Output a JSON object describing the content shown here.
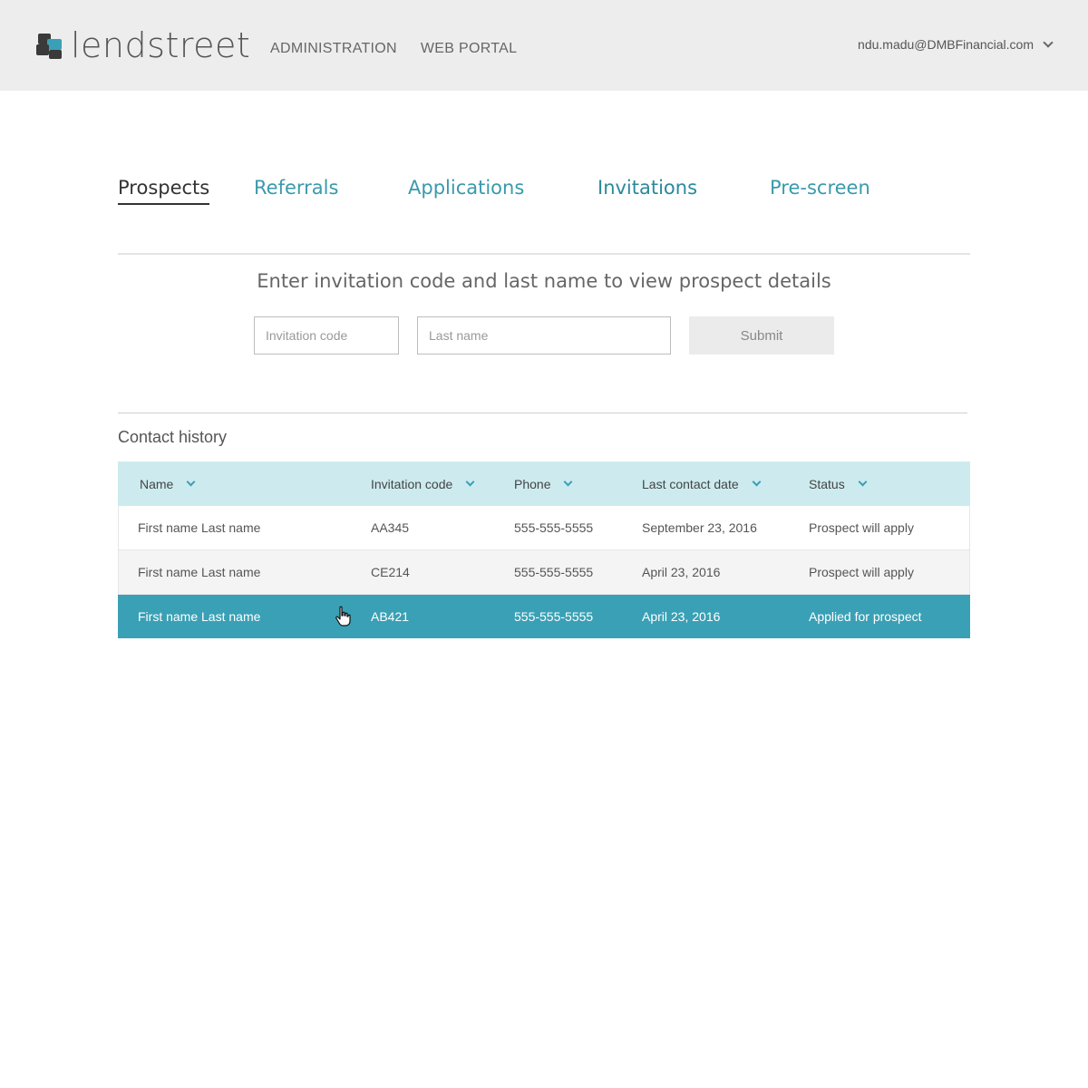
{
  "header": {
    "brand_name": "lendstreet",
    "nav": [
      "ADMINISTRATION",
      "WEB PORTAL"
    ],
    "user_email": "ndu.madu@DMBFinancial.com"
  },
  "tabs": [
    {
      "label": "Prospects",
      "active": true
    },
    {
      "label": "Referrals",
      "active": false
    },
    {
      "label": "Applications",
      "active": false
    },
    {
      "label": "Invitations",
      "active": false
    },
    {
      "label": "Pre-screen",
      "active": false
    }
  ],
  "lookup": {
    "heading": "Enter invitation code and last name to view prospect details",
    "code_placeholder": "Invitation code",
    "code_value": "",
    "last_name_placeholder": "Last name",
    "last_name_value": "",
    "submit_label": "Submit"
  },
  "contact_history": {
    "title": "Contact history",
    "columns": [
      "Name",
      "Invitation code",
      "Phone",
      "Last contact date",
      "Status"
    ],
    "rows": [
      {
        "name": "First name Last name",
        "code": "AA345",
        "phone": "555-555-5555",
        "date": "September 23, 2016",
        "status": "Prospect will apply"
      },
      {
        "name": "First name Last name",
        "code": "CE214",
        "phone": "555-555-5555",
        "date": "April 23, 2016",
        "status": "Prospect will apply"
      },
      {
        "name": "First name Last name",
        "code": "AB421",
        "phone": "555-555-5555",
        "date": "April 23, 2016",
        "status": "Applied for prospect",
        "selected": true
      }
    ]
  },
  "colors": {
    "accent": "#3aa0b5",
    "header_bg": "#ededed",
    "table_header_bg": "#cdebef",
    "selected_row_bg": "#3aa0b5"
  },
  "icons": {
    "logo": "lendstreet-logo-icon",
    "user_menu": "chevron-down-icon",
    "sort": "chevron-down-icon",
    "pointer": "hand-cursor-icon"
  }
}
